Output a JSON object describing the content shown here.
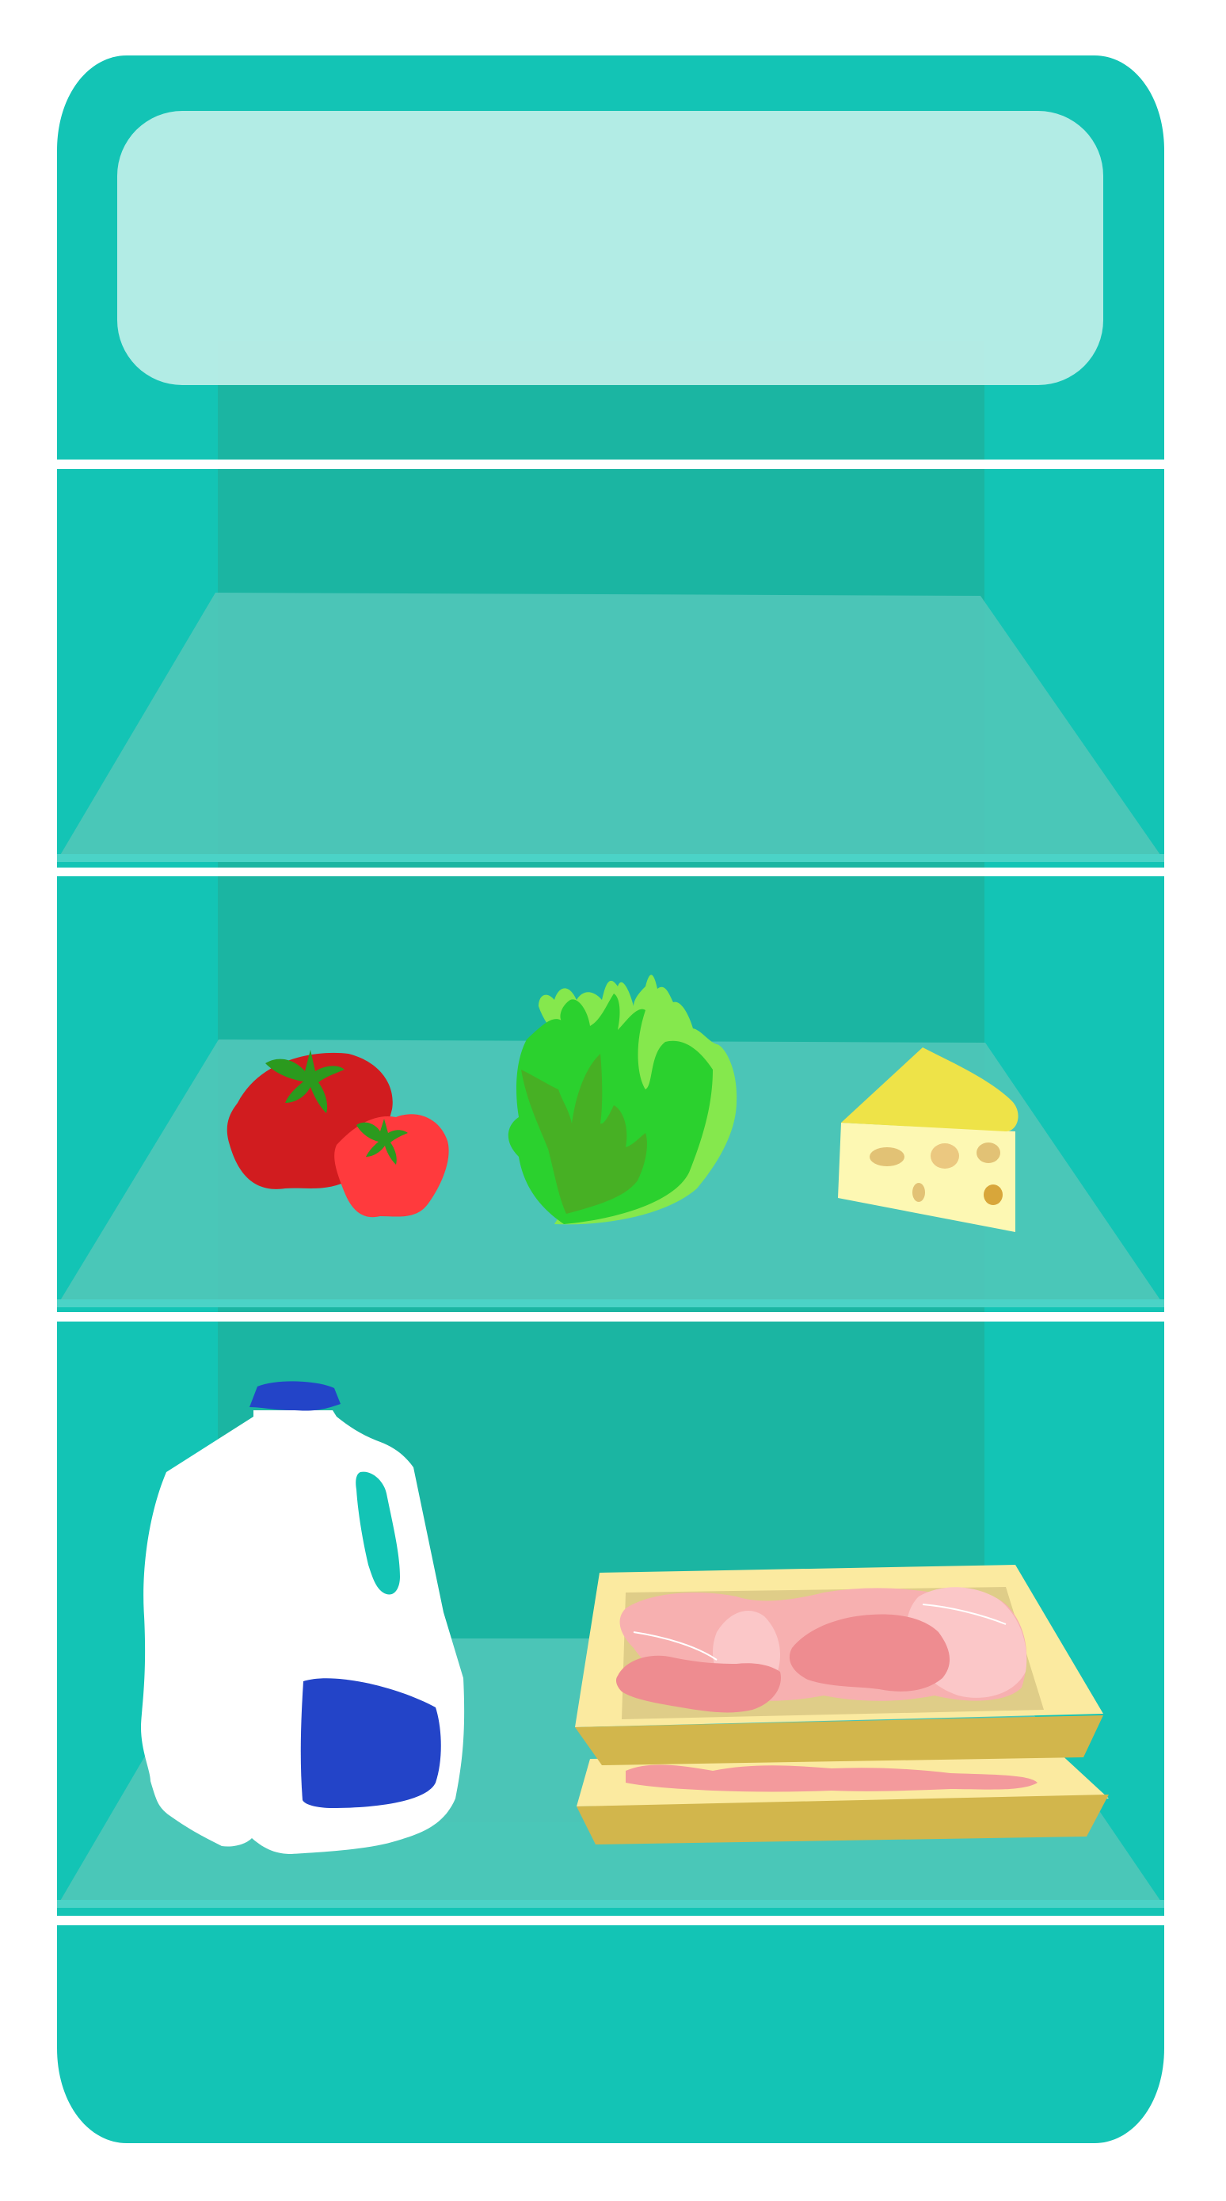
{
  "scene": {
    "subject": "open-refrigerator-illustration",
    "colors": {
      "background": "#ffffff",
      "fridge_body": "#13c4b5",
      "fridge_back": "#1bb5a2",
      "shelf_glass": "#4fc7b8",
      "shelf_glass_edge": "#4bd3c7",
      "shelf_divider": "#ffffff",
      "freezer_panel": "#b9ede7"
    },
    "shelves": [
      {
        "id": "top-shelf",
        "items": []
      },
      {
        "id": "middle-shelf",
        "items": [
          "tomato-icon",
          "lettuce-icon",
          "cheese-icon"
        ]
      },
      {
        "id": "bottom-shelf",
        "items": [
          "milk-jug-icon",
          "meat-tray-icon"
        ]
      }
    ],
    "item_colors": {
      "tomato_dark": "#d11c1f",
      "tomato_light": "#ff3a3d",
      "tomato_leaf": "#2b9a1e",
      "lettuce_outer": "#85e84d",
      "lettuce_mid": "#2bd12e",
      "lettuce_inner": "#47b024",
      "cheese_top": "#eee348",
      "cheese_front": "#fdf8b3",
      "cheese_hole": "#e2c275",
      "milk_body": "#ffffff",
      "milk_cap": "#2344c8",
      "milk_label": "#2344c8",
      "tray_front": "#fbeaa0",
      "tray_base": "#d2b64c",
      "meat_pink": "#f39a9c",
      "meat_light": "#fbc7c8"
    }
  }
}
